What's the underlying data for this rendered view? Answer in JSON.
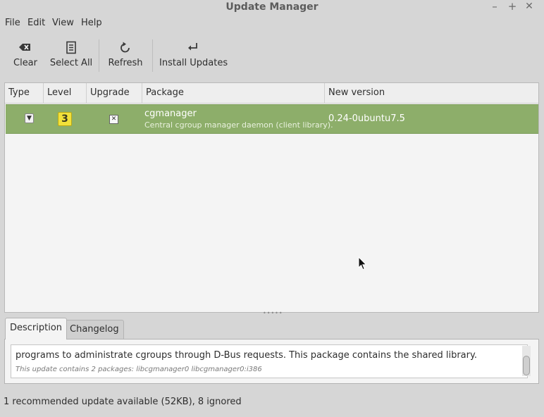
{
  "window": {
    "title": "Update Manager",
    "min": "–",
    "max": "+",
    "close": "✕"
  },
  "menu": [
    "File",
    "Edit",
    "View",
    "Help"
  ],
  "toolbar": {
    "clear": {
      "label": "Clear",
      "icon": "backspace-icon"
    },
    "select_all": {
      "label": "Select All",
      "icon": "select-all-icon"
    },
    "refresh": {
      "label": "Refresh",
      "icon": "refresh-icon"
    },
    "install": {
      "label": "Install Updates",
      "icon": "install-icon"
    }
  },
  "table": {
    "columns": [
      "Type",
      "Level",
      "Upgrade",
      "Package",
      "New version"
    ],
    "rows": [
      {
        "type_icon": "package-update-icon",
        "level": "3",
        "upgrade_checked": true,
        "package": "cgmanager",
        "description": "Central cgroup manager daemon (client library).",
        "new_version": "0.24-0ubuntu7.5",
        "selected": true
      }
    ]
  },
  "tabs": {
    "description": "Description",
    "changelog": "Changelog"
  },
  "details": {
    "text": "programs to administrate cgroups through D-Bus requests. This package contains the shared library.",
    "info": "This update contains 2 packages:  libcgmanager0 libcgmanager0:i386"
  },
  "status": "1 recommended update available (52KB), 8 ignored",
  "colors": {
    "selected_row": "#8dae6a",
    "level_3": "#f2e13a"
  }
}
